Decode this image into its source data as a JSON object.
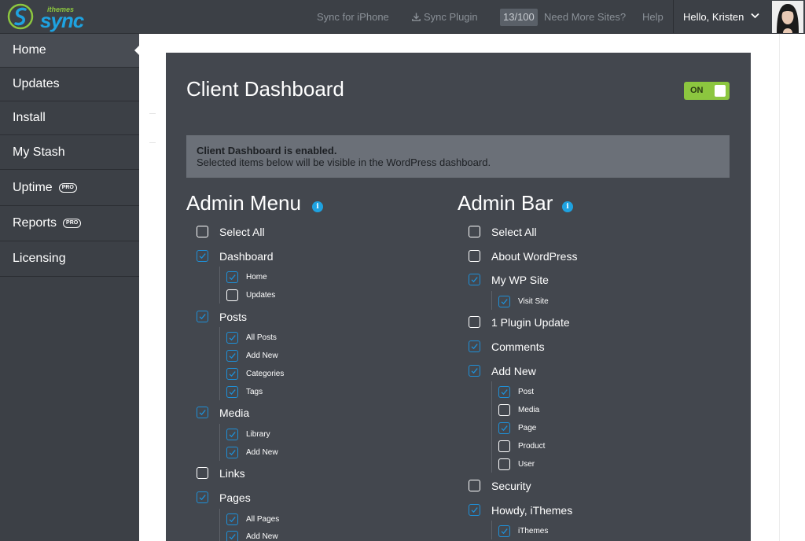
{
  "brand": {
    "small": "ithemes",
    "big": "sync"
  },
  "topnav": {
    "sync_iphone": "Sync for iPhone",
    "sync_plugin": "Sync Plugin",
    "site_count": "13/100",
    "need_more": "Need More Sites?",
    "help": "Help",
    "hello": "Hello, Kristen"
  },
  "sidebar": {
    "items": [
      {
        "label": "Home",
        "active": true
      },
      {
        "label": "Updates"
      },
      {
        "label": "Install"
      },
      {
        "label": "My Stash"
      },
      {
        "label": "Uptime",
        "badge": "PRO"
      },
      {
        "label": "Reports",
        "badge": "PRO"
      },
      {
        "label": "Licensing"
      }
    ]
  },
  "panel": {
    "title": "Client Dashboard",
    "toggle_label": "ON",
    "notice_strong": "Client Dashboard is enabled.",
    "notice_text": "Selected items below will be visible in the WordPress dashboard.",
    "info_glyph": "i"
  },
  "admin_menu": {
    "heading": "Admin Menu",
    "items": [
      {
        "label": "Select All",
        "checked": false,
        "level": 0
      },
      {
        "label": "Dashboard",
        "checked": true,
        "level": 0
      },
      {
        "label": "Home",
        "checked": true,
        "level": 1
      },
      {
        "label": "Updates",
        "checked": false,
        "level": 1
      },
      {
        "label": "Posts",
        "checked": true,
        "level": 0
      },
      {
        "label": "All Posts",
        "checked": true,
        "level": 1
      },
      {
        "label": "Add New",
        "checked": true,
        "level": 1
      },
      {
        "label": "Categories",
        "checked": true,
        "level": 1
      },
      {
        "label": "Tags",
        "checked": true,
        "level": 1
      },
      {
        "label": "Media",
        "checked": true,
        "level": 0
      },
      {
        "label": "Library",
        "checked": true,
        "level": 1
      },
      {
        "label": "Add New",
        "checked": true,
        "level": 1
      },
      {
        "label": "Links",
        "checked": false,
        "level": 0
      },
      {
        "label": "Pages",
        "checked": true,
        "level": 0
      },
      {
        "label": "All Pages",
        "checked": true,
        "level": 1
      },
      {
        "label": "Add New",
        "checked": true,
        "level": 1
      }
    ]
  },
  "admin_bar": {
    "heading": "Admin Bar",
    "items": [
      {
        "label": "Select All",
        "checked": false,
        "level": 0
      },
      {
        "label": "About WordPress",
        "checked": false,
        "level": 0
      },
      {
        "label": "My WP Site",
        "checked": true,
        "level": 0
      },
      {
        "label": "Visit Site",
        "checked": true,
        "level": 1
      },
      {
        "label": "1 Plugin Update",
        "checked": false,
        "level": 0
      },
      {
        "label": "Comments",
        "checked": true,
        "level": 0
      },
      {
        "label": "Add New",
        "checked": true,
        "level": 0
      },
      {
        "label": "Post",
        "checked": true,
        "level": 1
      },
      {
        "label": "Media",
        "checked": false,
        "level": 1
      },
      {
        "label": "Page",
        "checked": true,
        "level": 1
      },
      {
        "label": "Product",
        "checked": false,
        "level": 1
      },
      {
        "label": "User",
        "checked": false,
        "level": 1
      },
      {
        "label": "Security",
        "checked": false,
        "level": 0
      },
      {
        "label": "Howdy, iThemes",
        "checked": true,
        "level": 0
      },
      {
        "label": "iThemes",
        "checked": true,
        "level": 1
      }
    ]
  },
  "colors": {
    "topbar": "#3c4046",
    "panel": "#43474e",
    "accent_blue": "#1ea2e0",
    "toggle_green": "#8cc63f",
    "notice_bg": "#6b7078"
  }
}
